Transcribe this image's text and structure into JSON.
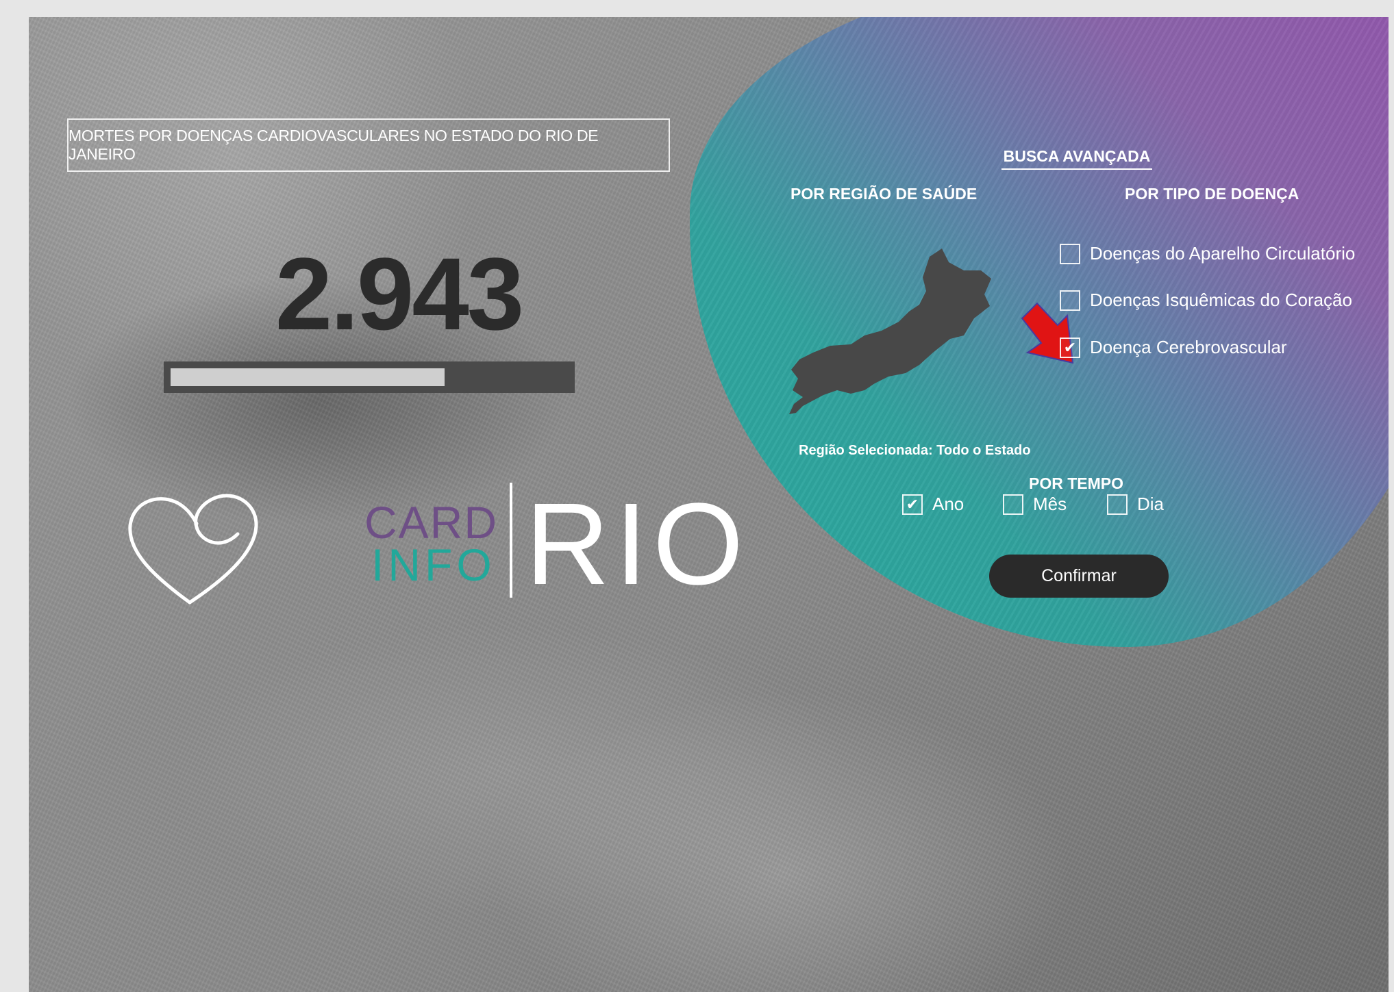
{
  "header": {
    "title": "MORTES POR DOENÇAS CARDIOVASCULARES NO ESTADO DO RIO DE JANEIRO"
  },
  "stats": {
    "count": "2.943",
    "progress_fraction": 0.69
  },
  "logo": {
    "card": "CARD",
    "info": "INFO",
    "rio": "RIO",
    "heart_icon": "heart-icon"
  },
  "search": {
    "title": "BUSCA AVANÇADA",
    "region_heading": "POR REGIÃO DE SAÚDE",
    "disease_heading": "POR TIPO DE DOENÇA",
    "selected_region": "Região Selecionada: Todo o Estado",
    "diseases": [
      {
        "label": "Doenças do Aparelho Circulatório",
        "checked": false
      },
      {
        "label": "Doenças Isquêmicas do Coração",
        "checked": false
      },
      {
        "label": "Doença Cerebrovascular",
        "checked": true
      }
    ],
    "time_heading": "POR TEMPO",
    "time_options": [
      {
        "label": "Ano",
        "checked": true
      },
      {
        "label": "Mês",
        "checked": false
      },
      {
        "label": "Dia",
        "checked": false
      }
    ],
    "confirm_label": "Confirmar"
  },
  "colors": {
    "teal": "#1fada0",
    "purple": "#9550b0",
    "annotation_arrow": "#e01414"
  }
}
